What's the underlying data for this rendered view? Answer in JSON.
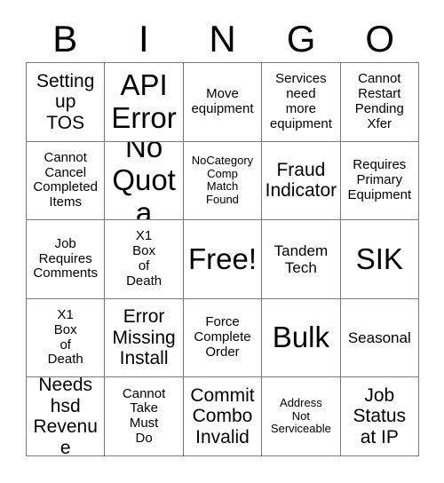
{
  "card": {
    "title_letters": [
      "B",
      "I",
      "N",
      "G",
      "O"
    ],
    "grid_size": "5x5",
    "free_space_label": "Free!",
    "colors": {
      "background": "#ffffff",
      "text": "#000000",
      "gridline": "#7a7a7a"
    },
    "rows": [
      [
        {
          "text": "Setting\nup\nTOS",
          "size": "fs-l"
        },
        {
          "text": "API\nError",
          "size": "fs-xxl"
        },
        {
          "text": "Move\nequipment",
          "size": "fs-s"
        },
        {
          "text": "Services\nneed\nmore\nequipment",
          "size": "fs-s"
        },
        {
          "text": "Cannot\nRestart\nPending\nXfer",
          "size": "fs-s"
        }
      ],
      [
        {
          "text": "Cannot\nCancel\nCompleted\nItems",
          "size": "fs-s"
        },
        {
          "text": "No\nQuota",
          "size": "fs-xxl"
        },
        {
          "text": "NoCategory\nComp\nMatch\nFound",
          "size": "fs-xs"
        },
        {
          "text": "Fraud\nIndicator",
          "size": "fs-l"
        },
        {
          "text": "Requires\nPrimary\nEquipment",
          "size": "fs-s"
        }
      ],
      [
        {
          "text": "Job\nRequires\nComments",
          "size": "fs-s"
        },
        {
          "text": "X1\nBox\nof\nDeath",
          "size": "fs-s"
        },
        {
          "text": "Free!",
          "size": "fs-xxl"
        },
        {
          "text": "Tandem\nTech",
          "size": "fs-m"
        },
        {
          "text": "SIK",
          "size": "fs-xxl"
        }
      ],
      [
        {
          "text": "X1\nBox\nof\nDeath",
          "size": "fs-s"
        },
        {
          "text": "Error\nMissing\nInstall",
          "size": "fs-l"
        },
        {
          "text": "Force\nComplete\nOrder",
          "size": "fs-s"
        },
        {
          "text": "Bulk",
          "size": "fs-xxl"
        },
        {
          "text": "Seasonal",
          "size": "fs-m"
        }
      ],
      [
        {
          "text": "Needs\nhsd\nRevenue",
          "size": "fs-l"
        },
        {
          "text": "Cannot\nTake\nMust\nDo",
          "size": "fs-s"
        },
        {
          "text": "Commit\nCombo\nInvalid",
          "size": "fs-l"
        },
        {
          "text": "Address\nNot\nServiceable",
          "size": "fs-xs"
        },
        {
          "text": "Job\nStatus\nat IP",
          "size": "fs-l"
        }
      ]
    ]
  }
}
